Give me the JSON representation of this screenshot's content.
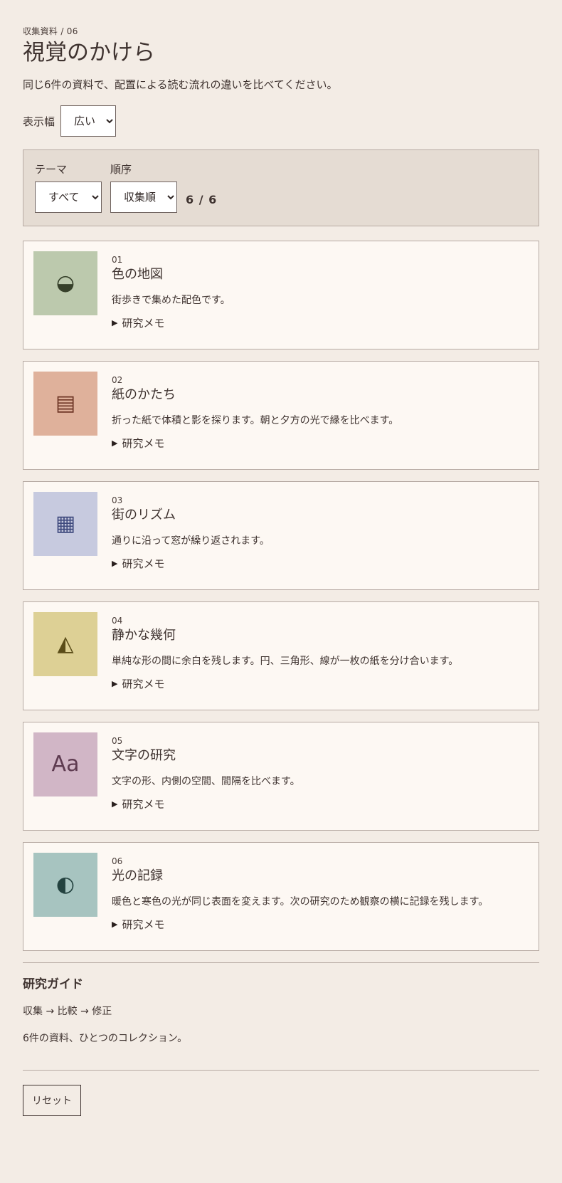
{
  "header": {
    "eyebrow": "収集資料 / 06",
    "title": "視覚のかけら",
    "intro": "同じ6件の資料で、配置による読む流れの違いを比べてください。"
  },
  "display_width": {
    "label": "表示幅",
    "selected": "広い"
  },
  "filters": {
    "theme_label": "テーマ",
    "theme_selected": "すべて",
    "order_label": "順序",
    "order_selected": "収集順",
    "count": "6 / 6"
  },
  "cards": [
    {
      "num": "01",
      "title": "色の地図",
      "desc": "街歩きで集めた配色です。",
      "memo": "研究メモ",
      "icon": "half-circle-icon",
      "glyph": "◒",
      "bg": "#bcc9ad",
      "fg": "#36402a"
    },
    {
      "num": "02",
      "title": "紙のかたち",
      "desc": "折った紙で体積と影を探ります。朝と夕方の光で縁を比べます。",
      "memo": "研究メモ",
      "icon": "stacked-lines-icon",
      "glyph": "▤",
      "bg": "#dfb19b",
      "fg": "#6d3525"
    },
    {
      "num": "03",
      "title": "街のリズム",
      "desc": "通りに沿って窓が繰り返されます。",
      "memo": "研究メモ",
      "icon": "grid-icon",
      "glyph": "▦",
      "bg": "#c7cadf",
      "fg": "#3f4a7e"
    },
    {
      "num": "04",
      "title": "静かな幾何",
      "desc": "単純な形の間に余白を残します。円、三角形、線が一枚の紙を分け合います。",
      "memo": "研究メモ",
      "icon": "triangle-icon",
      "glyph": "◭",
      "bg": "#ddd095",
      "fg": "#5a4c18"
    },
    {
      "num": "05",
      "title": "文字の研究",
      "desc": "文字の形、内側の空間、間隔を比べます。",
      "memo": "研究メモ",
      "icon": "typography-icon",
      "glyph": "Aa",
      "bg": "#d1b6c6",
      "fg": "#5e3b50"
    },
    {
      "num": "06",
      "title": "光の記録",
      "desc": "暖色と寒色の光が同じ表面を変えます。次の研究のため観察の横に記録を残します。",
      "memo": "研究メモ",
      "icon": "half-moon-icon",
      "glyph": "◐",
      "bg": "#a7c4c0",
      "fg": "#23423f"
    }
  ],
  "guide": {
    "title": "研究ガイド",
    "steps": "収集 → 比較 → 修正",
    "summary": "6件の資料、ひとつのコレクション。"
  },
  "reset_label": "リセット"
}
